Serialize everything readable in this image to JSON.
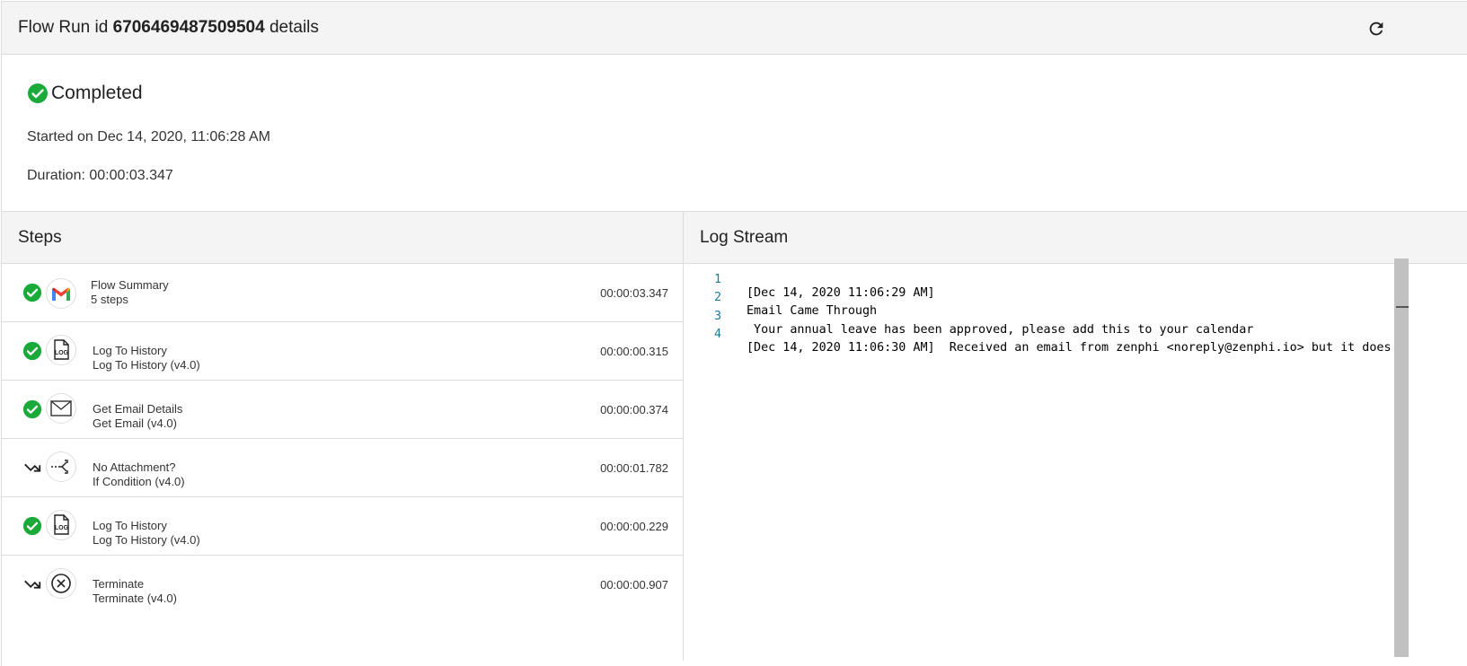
{
  "header": {
    "title_prefix": "Flow Run id",
    "run_id": "6706469487509504",
    "title_suffix": "details"
  },
  "summary": {
    "status": "Completed",
    "started": "Started on Dec 14, 2020, 11:06:28 AM",
    "duration": "Duration: 00:00:03.347"
  },
  "steps_panel": {
    "heading": "Steps",
    "items": [
      {
        "name": "Flow Summary",
        "sub": "5 steps",
        "time": "00:00:03.347",
        "status_icon": "check-circle-icon",
        "icon": "gmail-icon"
      },
      {
        "name": "Log To History",
        "sub": "Log To History (v4.0)",
        "time": "00:00:00.315",
        "status_icon": "check-circle-icon",
        "icon": "log-file-icon"
      },
      {
        "name": "Get Email Details",
        "sub": "Get Email (v4.0)",
        "time": "00:00:00.374",
        "status_icon": "check-circle-icon",
        "icon": "envelope-icon"
      },
      {
        "name": "No Attachment?",
        "sub": "If Condition (v4.0)",
        "time": "00:00:01.782",
        "status_icon": "skipped-arrow-icon",
        "icon": "branch-icon"
      },
      {
        "name": "Log To History",
        "sub": "Log To History (v4.0)",
        "time": "00:00:00.229",
        "status_icon": "check-circle-icon",
        "icon": "log-file-icon"
      },
      {
        "name": "Terminate",
        "sub": "Terminate (v4.0)",
        "time": "00:00:00.907",
        "status_icon": "skipped-arrow-icon",
        "icon": "terminate-icon"
      }
    ]
  },
  "log_panel": {
    "heading": "Log Stream",
    "lines": [
      {
        "num": "1",
        "text": "[Dec 14, 2020 11:06:29 AM]"
      },
      {
        "num": "2",
        "text": "Email Came Through"
      },
      {
        "num": "3",
        "text": " Your annual leave has been approved, please add this to your calendar"
      },
      {
        "num": "4",
        "text": "[Dec 14, 2020 11:06:30 AM]  Received an email from zenphi <noreply@zenphi.io> but it does"
      }
    ]
  },
  "colors": {
    "success": "#1aaa3a",
    "line_number": "#237893",
    "header_bg": "#f4f4f4"
  }
}
